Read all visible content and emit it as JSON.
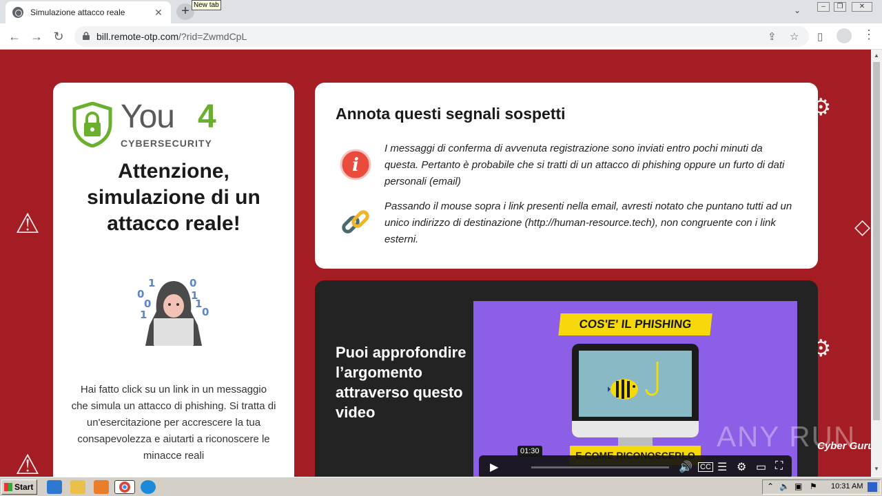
{
  "browser": {
    "tab_title": "Simulazione attacco reale",
    "new_tab_tooltip": "New tab",
    "url_host": "bill.remote-otp.com",
    "url_rest": "/?rid=ZwmdCpL"
  },
  "logo": {
    "you": "You",
    "four": "4",
    "sub": "CYBERSECURITY"
  },
  "left": {
    "headline": "Attenzione, simulazione di un attacco reale!",
    "body": "Hai fatto click su un link in un messaggio che simula un attacco di phishing. Si tratta di un'esercitazione per accrescere la tua consapevolezza e aiutarti a riconoscere le minacce reali"
  },
  "signs": {
    "title": "Annota questi segnali sospetti",
    "items": [
      {
        "icon": "info-icon",
        "text": "I messaggi di conferma di avvenuta registrazione sono inviati entro pochi minuti da questa. Pertanto è probabile che si tratti di un attacco di phishing oppure un furto di dati personali (email)"
      },
      {
        "icon": "chain-link-icon",
        "text": "Passando il mouse sopra i link presenti nella email, avresti notato che puntano tutti ad un unico indirizzo di destinazione (http://human-resource.tech), non congruente con i link esterni."
      }
    ]
  },
  "video": {
    "cta": "Puoi approfondire l’argomento attraverso questo video",
    "banner_top": "COS'E' IL PHISHING",
    "banner_bottom": "E COME RICONOSCERLO",
    "time": "01:30"
  },
  "overlay": {
    "watermark": "ANY RUN",
    "brand": "Cyber Guru"
  },
  "taskbar": {
    "start": "Start",
    "clock": "10:31 AM"
  }
}
